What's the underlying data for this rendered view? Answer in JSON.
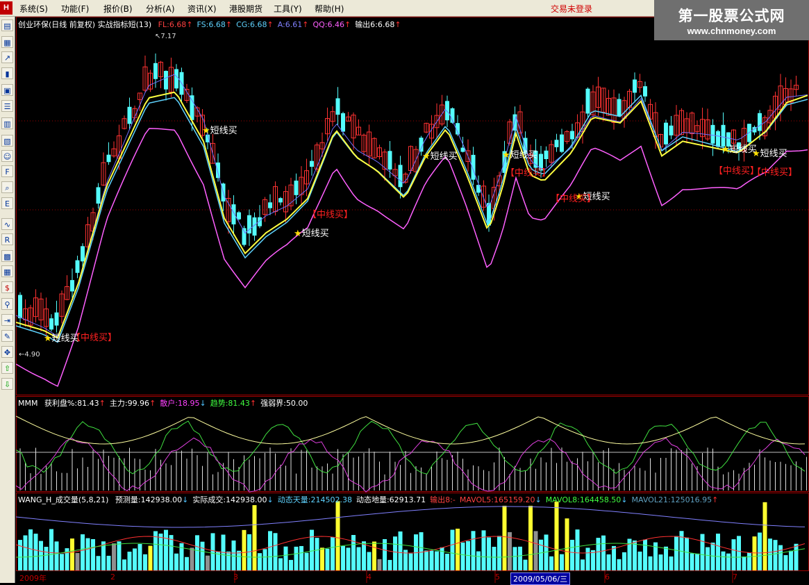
{
  "menu": {
    "logo": "H",
    "items": [
      "系统(S)",
      "功能(F)",
      "报价(B)",
      "分析(A)",
      "资讯(X)",
      "港股期货",
      "工具(Y)",
      "帮助(H)"
    ],
    "login_status": "交易未登录"
  },
  "watermark": {
    "name": "第一股票公式网",
    "url": "www.chnmoney.com"
  },
  "toolbar_icons": [
    "quote-list-icon",
    "grid-icon",
    "line-chart-icon",
    "candle-chart-icon",
    "window-icon",
    "list-icon",
    "notes-icon",
    "box-icon",
    "users-icon",
    "f10-icon",
    "search-icon",
    "etf-icon",
    "wave-icon",
    "rsi-icon",
    "indicator-icon",
    "calc-icon",
    "dollar-icon",
    "link-icon",
    "export-icon",
    "pencil-icon",
    "move-icon",
    "arrow-up-icon",
    "arrow-down-icon"
  ],
  "main_panel": {
    "title": "创业环保(日线 前复权) 实战指标短(13)",
    "indicators": [
      {
        "label": "FL:6.68",
        "arrow": "↑",
        "color": "#ff4040"
      },
      {
        "label": "FS:6.68",
        "arrow": "↑",
        "color": "#5fd3ff"
      },
      {
        "label": "CG:6.68",
        "arrow": "↑",
        "color": "#5fd3ff"
      },
      {
        "label": "A:6.61",
        "arrow": "↑",
        "color": "#8080ff"
      },
      {
        "label": "QQ:6.46",
        "arrow": "↑",
        "color": "#ff60ff"
      },
      {
        "label": "输出6:6.68",
        "arrow": "↑",
        "color": "#ffffff"
      }
    ],
    "high_label": "7.17",
    "low_label": "4.90",
    "signals_short": [
      {
        "text": "短线买"
      },
      {
        "text": "短线买"
      },
      {
        "text": "短线买"
      },
      {
        "text": "短线买"
      },
      {
        "text": "短线买"
      },
      {
        "text": "短线买"
      },
      {
        "text": "短线买"
      },
      {
        "text": "短线买"
      }
    ],
    "signals_mid": [
      {
        "text": "【中线买】"
      },
      {
        "text": "【中线买】"
      },
      {
        "text": "【中线买】"
      },
      {
        "text": "【中线买】"
      },
      {
        "text": "【中线买】"
      },
      {
        "text": "【中线买】"
      }
    ]
  },
  "mmm_panel": {
    "name": "MMM",
    "indicators": [
      {
        "label": "获利盘%:81.43",
        "arrow": "↑",
        "color": "#ffffff"
      },
      {
        "label": "主力:99.96",
        "arrow": "↑",
        "color": "#ffffff"
      },
      {
        "label": "散户:18.95",
        "arrow": "↓",
        "color": "#ff40ff"
      },
      {
        "label": "趋势:81.43",
        "arrow": "↑",
        "color": "#40ff40"
      },
      {
        "label": "强弱界:50.00",
        "arrow": "",
        "color": "#ffffff"
      }
    ]
  },
  "volume_panel": {
    "name": "WANG_H_成交量(5,8,21)",
    "indicators": [
      {
        "label": "预测量:142938.00",
        "arrow": "↓",
        "color": "#ffffff"
      },
      {
        "label": "实际成交:142938.00",
        "arrow": "↓",
        "color": "#ffffff"
      },
      {
        "label": "动态天量:214502.38",
        "arrow": "",
        "color": "#5fd3ff"
      },
      {
        "label": "动态地量:62913.71",
        "arrow": "",
        "color": "#ffffff"
      },
      {
        "label": "输出8:-",
        "arrow": "",
        "color": "#ff4040"
      },
      {
        "label": "MAVOL5:165159.20",
        "arrow": "↓",
        "color": "#ff4040"
      },
      {
        "label": "MAVOL8:164458.50",
        "arrow": "↓",
        "color": "#40ff40"
      },
      {
        "label": "MAVOL21:125016.95",
        "arrow": "↑",
        "color": "#5fa0c0"
      }
    ]
  },
  "date_axis": {
    "labels": [
      "2009年",
      "2",
      "3",
      "4",
      "5",
      "6",
      "7"
    ],
    "cursor_date": "2009/05/06/三"
  },
  "colors": {
    "up": "#ff3232",
    "down": "#54fcfc",
    "ma_yellow": "#ffff40",
    "ma_blue": "#7070ff",
    "ma_pink": "#ff60ff"
  }
}
